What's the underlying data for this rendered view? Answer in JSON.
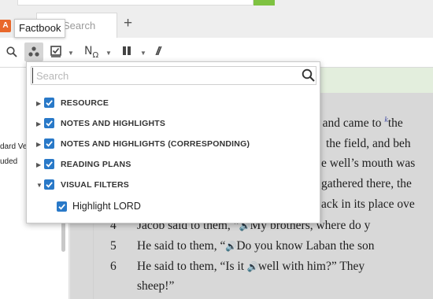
{
  "tabs": [
    {
      "label": "Search"
    }
  ],
  "tooltip": "Factbook",
  "app_icon": "A",
  "toolbar": {
    "icons": [
      "search-icon",
      "visual-filters-icon",
      "checklist-icon",
      "interlinear-icon",
      "parallel-icon",
      "text-compare-icon"
    ]
  },
  "dropdown": {
    "search_placeholder": "Search",
    "items": [
      {
        "label": "RESOURCE",
        "checked": true,
        "expanded": false
      },
      {
        "label": "NOTES AND HIGHLIGHTS",
        "checked": true,
        "expanded": false
      },
      {
        "label": "NOTES AND HIGHLIGHTS (CORRESPONDING)",
        "checked": true,
        "expanded": false
      },
      {
        "label": "READING PLANS",
        "checked": true,
        "expanded": false
      },
      {
        "label": "VISUAL FILTERS",
        "checked": true,
        "expanded": true
      }
    ],
    "subitems": [
      {
        "label": "Highlight LORD",
        "checked": true
      }
    ]
  },
  "left_panel": {
    "texts": [
      "dard Ve",
      "uded"
    ]
  },
  "reader": {
    "partial_lines": [
      "y and came to ",
      " the field, and beh",
      "e well’s mouth was",
      "gathered there, the",
      "ack in its place ove"
    ],
    "superscript": "k",
    "verses": [
      {
        "num": "4",
        "before": "Jacob said to them, “",
        "after": "My brothers, where do y"
      },
      {
        "num": "5",
        "before": "He said to them, “",
        "after": "Do you know Laban the son"
      },
      {
        "num": "6",
        "before": "He said to them, “Is it ",
        "after": "well with him?” They"
      }
    ],
    "last_line": "sheep!”",
    "verse_tail": "the",
    "speaker_glyph": "🔊"
  },
  "colors": {
    "accent": "#2979c8",
    "brand": "#e8682b",
    "go": "#7ec241",
    "reader_bar": "#e3eedd"
  }
}
